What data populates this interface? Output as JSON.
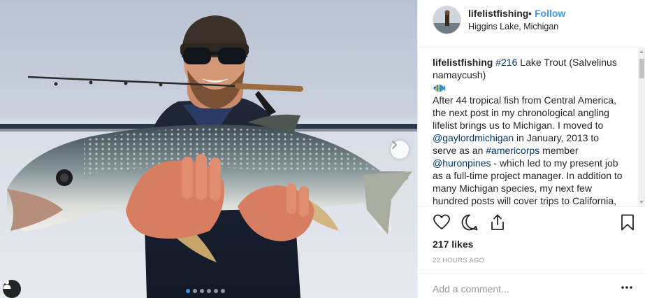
{
  "post": {
    "username": "lifelistfishing",
    "follow_label": "Follow",
    "follow_bullet": "•",
    "location": "Higgins Lake, Michigan",
    "photo": {
      "description_icon": "fish-photo",
      "carousel_dots": 6,
      "active_dot": 1,
      "next_icon": "chevron-right-icon",
      "user_tag_icon": "person-icon"
    },
    "caption": {
      "username": "lifelistfishing",
      "hashtag_1": "#216",
      "text_1": " Lake Trout (Salvelinus namaycush)",
      "emoji_icon": "tropical-fish-emoji",
      "text_2": "After 44 tropical fish from Central America, the next post in my chronological angling lifelist brings us to Michigan. I moved to ",
      "mention_1": "@gaylordmichigan",
      "text_3": " in January, 2013 to serve as an ",
      "hashtag_2": "#americorps",
      "text_4": " member ",
      "mention_2": "@huronpines",
      "text_5": " - which led to my present job as a full-time project manager. In addition to many Michigan species, my next few hundred posts will cover trips to California, Florida and the Pacific Northwest."
    },
    "actions": {
      "like_icon": "heart-icon",
      "comment_icon": "comment-icon",
      "share_icon": "share-icon",
      "save_icon": "bookmark-icon"
    },
    "likes": "217 likes",
    "timestamp": "22 HOURS AGO",
    "comment": {
      "placeholder": "Add a comment...",
      "value": "",
      "more_icon": "more-options-icon"
    }
  },
  "colors": {
    "link": "#3897f0",
    "hashtag": "#003569",
    "text": "#262626",
    "muted": "#999999",
    "border": "#efefef"
  }
}
